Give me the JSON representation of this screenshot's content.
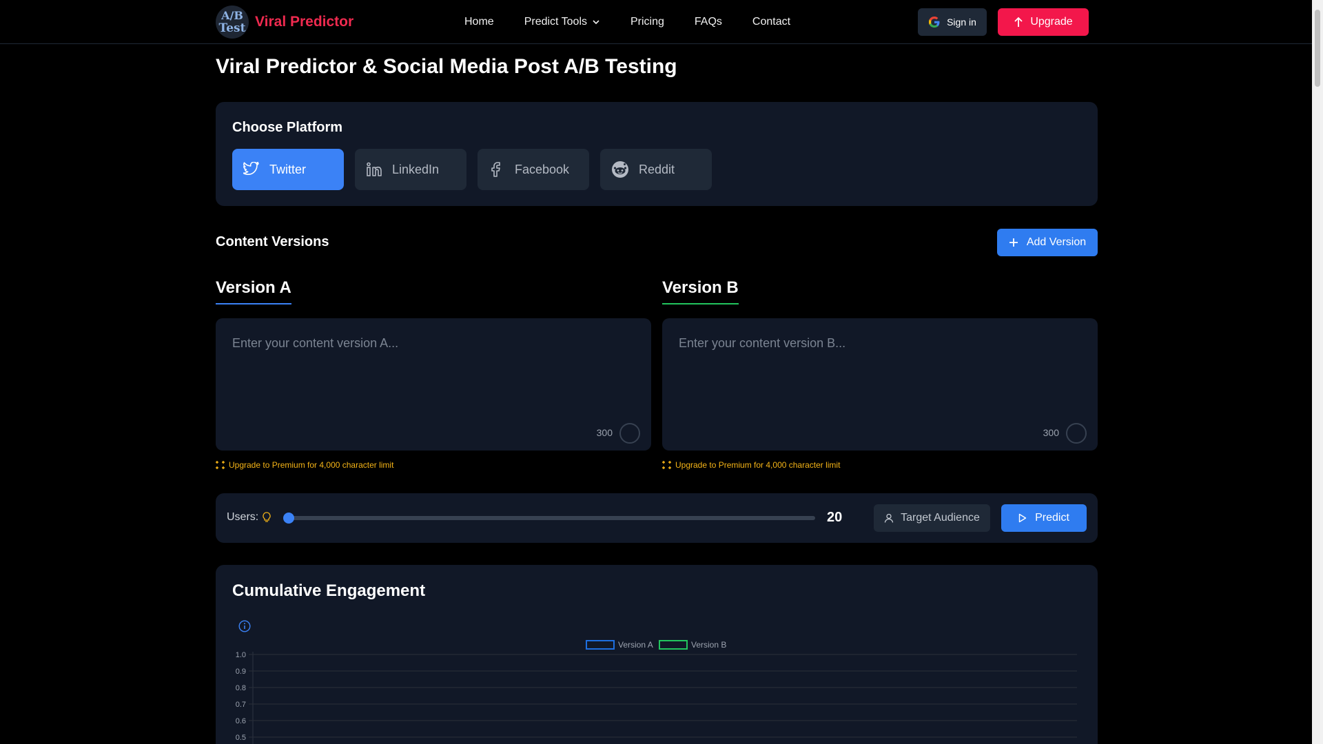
{
  "nav": {
    "logo_line1": "A/B",
    "logo_line2": "Test",
    "brand": "Viral Predictor",
    "links": [
      "Home",
      "Predict Tools",
      "Pricing",
      "FAQs",
      "Contact"
    ],
    "signin_label": "Sign in",
    "upgrade_label": "Upgrade"
  },
  "page": {
    "title": "Viral Predictor & Social Media Post A/B Testing"
  },
  "platform": {
    "heading": "Choose Platform",
    "options": [
      {
        "label": "Twitter",
        "icon": "twitter-icon",
        "active": true
      },
      {
        "label": "LinkedIn",
        "icon": "linkedin-icon",
        "active": false
      },
      {
        "label": "Facebook",
        "icon": "facebook-icon",
        "active": false
      },
      {
        "label": "Reddit",
        "icon": "reddit-icon",
        "active": false
      }
    ]
  },
  "content": {
    "heading": "Content Versions",
    "add_version_label": "Add Version",
    "version_a": {
      "tab": "Version A",
      "placeholder": "Enter your content version A...",
      "char_count": "300",
      "upsell": "Upgrade to Premium for 4,000 character limit"
    },
    "version_b": {
      "tab": "Version B",
      "placeholder": "Enter your content version B...",
      "char_count": "300",
      "upsell": "Upgrade to Premium for 4,000 character limit"
    }
  },
  "controls": {
    "users_label": "Users:",
    "users_value": "20",
    "slider_fraction": 0.0,
    "target_audience_label": "Target Audience",
    "predict_label": "Predict"
  },
  "colors": {
    "accent": "#3b82f6",
    "brand_red": "#f3174b",
    "version_a": "#1e6fe0",
    "version_b": "#22c55e",
    "upsell": "#f5b417"
  },
  "chart_data": {
    "type": "line",
    "title": "Cumulative Engagement",
    "series": [
      {
        "name": "Version A",
        "values": []
      },
      {
        "name": "Version B",
        "values": []
      }
    ],
    "y_ticks": [
      "1.0",
      "0.9",
      "0.8",
      "0.7",
      "0.6",
      "0.5"
    ],
    "ylim": [
      0,
      1.0
    ],
    "grid": true,
    "legend": "top-center"
  }
}
